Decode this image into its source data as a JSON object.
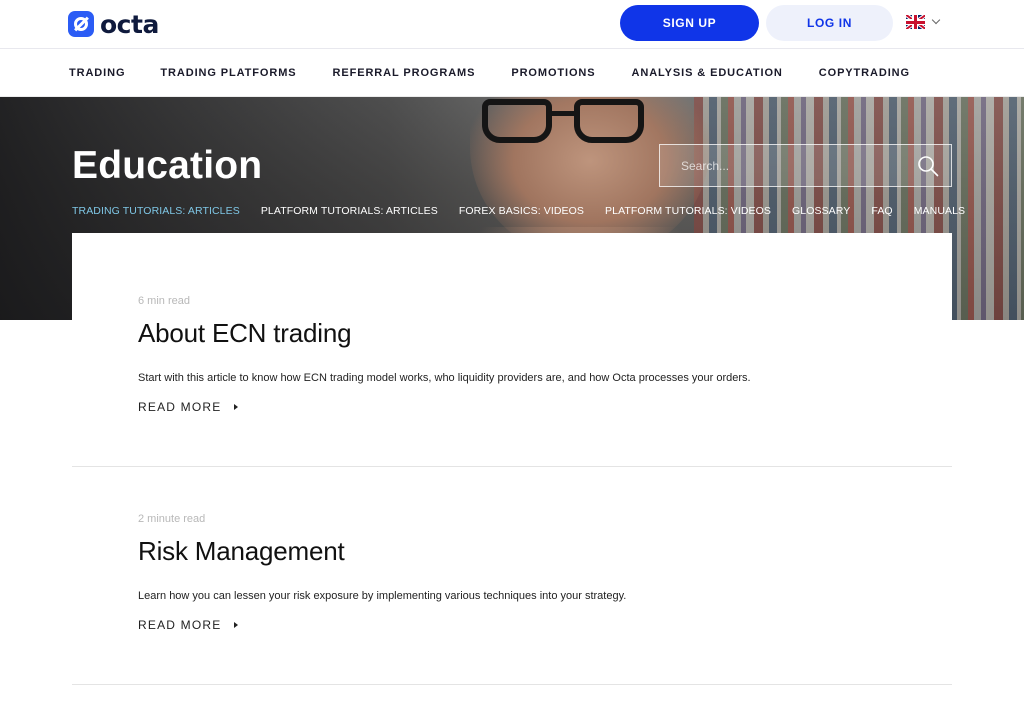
{
  "header": {
    "logo_text": "octa",
    "signup_label": "SIGN UP",
    "login_label": "LOG IN",
    "language": "en-GB flag"
  },
  "main_nav": {
    "items": [
      {
        "label": "TRADING"
      },
      {
        "label": "TRADING PLATFORMS"
      },
      {
        "label": "REFERRAL PROGRAMS"
      },
      {
        "label": "PROMOTIONS"
      },
      {
        "label": "ANALYSIS & EDUCATION"
      },
      {
        "label": "COPYTRADING"
      }
    ]
  },
  "hero": {
    "title": "Education",
    "search_placeholder": "Search...",
    "subnav": [
      {
        "label": "TRADING TUTORIALS: ARTICLES",
        "active": true
      },
      {
        "label": "PLATFORM TUTORIALS: ARTICLES",
        "active": false
      },
      {
        "label": "FOREX BASICS: VIDEOS",
        "active": false
      },
      {
        "label": "PLATFORM TUTORIALS: VIDEOS",
        "active": false
      },
      {
        "label": "GLOSSARY",
        "active": false
      },
      {
        "label": "FAQ",
        "active": false
      },
      {
        "label": "MANUALS",
        "active": false
      }
    ]
  },
  "articles": [
    {
      "read_time": "6 min read",
      "title": "About ECN trading",
      "summary": "Start with this article to know how ECN trading model works, who liquidity providers are, and how Octa processes your orders.",
      "cta": "READ MORE"
    },
    {
      "read_time": "2 minute read",
      "title": "Risk Management",
      "summary": "Learn how you can lessen your risk exposure by implementing various techniques into your strategy.",
      "cta": "READ MORE"
    }
  ],
  "colors": {
    "brand_blue": "#1035e8",
    "login_bg": "#eef1fb",
    "subnav_active": "#7fc7e6"
  }
}
